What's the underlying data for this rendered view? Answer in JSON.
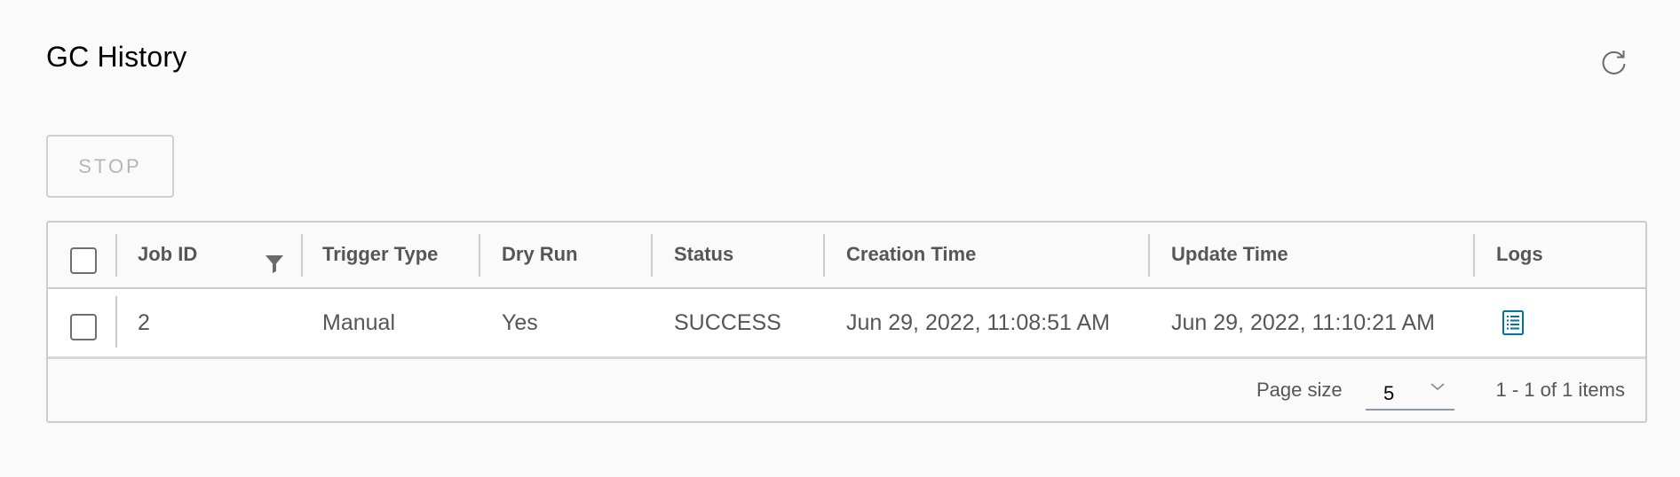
{
  "page": {
    "title": "GC History"
  },
  "toolbar": {
    "stop_label": "STOP",
    "refresh_icon": "refresh-icon"
  },
  "table": {
    "columns": [
      "Job ID",
      "Trigger Type",
      "Dry Run",
      "Status",
      "Creation Time",
      "Update Time",
      "Logs"
    ],
    "rows": [
      {
        "job_id": "2",
        "trigger_type": "Manual",
        "dry_run": "Yes",
        "status": "SUCCESS",
        "creation_time": "Jun 29, 2022, 11:08:51 AM",
        "update_time": "Jun 29, 2022, 11:10:21 AM",
        "logs_icon": "log-file-icon"
      }
    ]
  },
  "footer": {
    "page_size_label": "Page size",
    "page_size_value": "5",
    "pager_text": "1 - 1 of 1 items"
  },
  "colors": {
    "accent": "#0072a3",
    "text": "#565656",
    "border": "#cccccc"
  }
}
